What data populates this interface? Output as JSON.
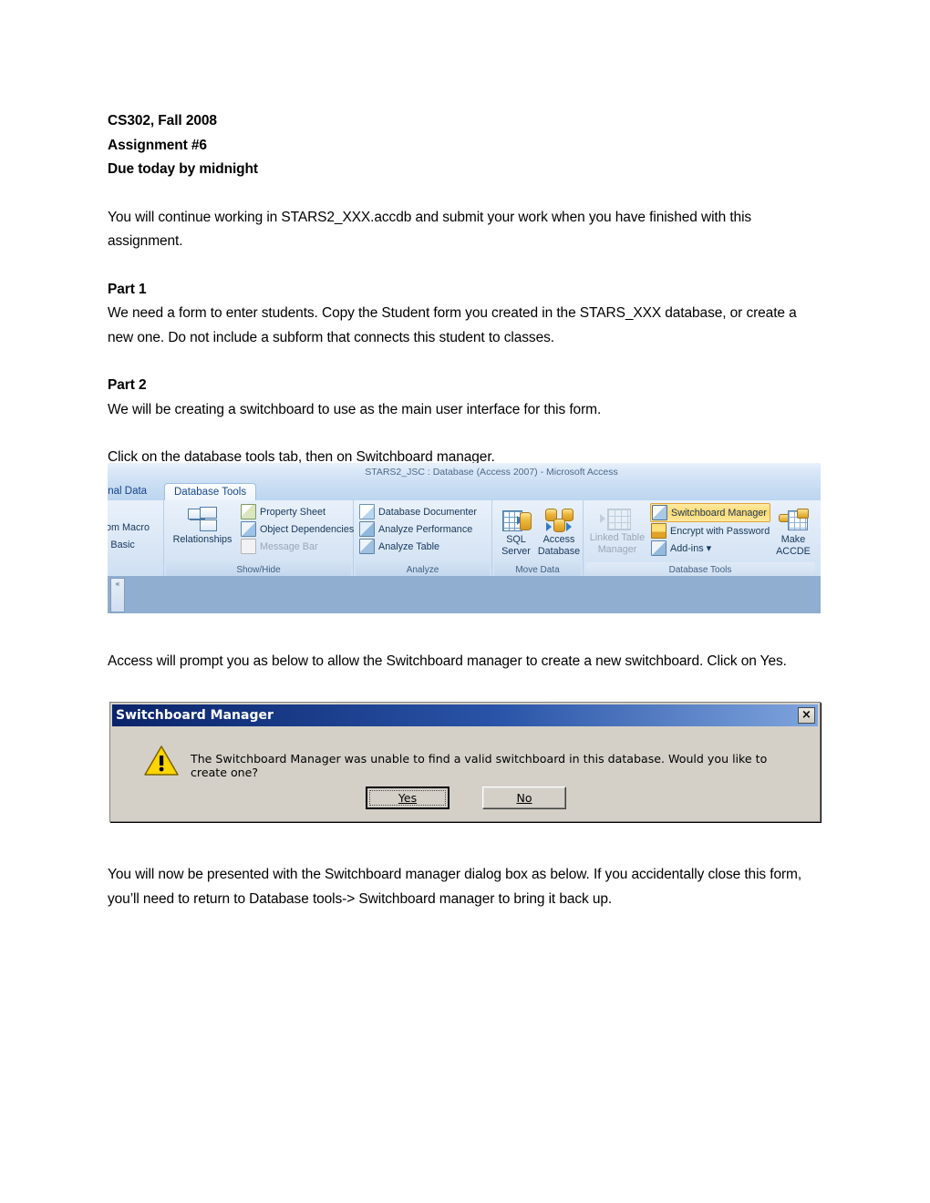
{
  "document": {
    "header_lines": [
      "CS302, Fall 2008",
      "Assignment #6",
      "Due today by midnight"
    ],
    "intro_paragraph": "You will continue working in STARS2_XXX.accdb and submit your work when you have finished with this assignment.",
    "part1_heading": "Part 1",
    "part1_paragraph": "We need a form to enter students. Copy the Student form you created in the STARS_XXX database, or create a new one. Do not include a subform that connects this student to classes.",
    "part2_heading": "Part 2",
    "part2_paragraph": "We will be creating a switchboard to use as the main user interface for this form.",
    "instruction_click_tab": "Click on the database tools tab, then on Switchboard manager.",
    "instruction_prompt": "Access will prompt you as below to allow the Switchboard manager to create a new switchboard. Click on Yes.",
    "instruction_dialog": "You will now be presented with the Switchboard manager dialog box as below. If you accidentally close this form, you’ll need to return to Database tools-> Switchboard manager to bring it back up."
  },
  "ribbon_screenshot": {
    "window_title": "STARS2_JSC : Database (Access 2007) - Microsoft Access",
    "tabs": [
      {
        "label": "ernal Data",
        "active": false
      },
      {
        "label": "Database Tools",
        "active": true
      }
    ],
    "cut_group_items": [
      "om Macro",
      "l Basic"
    ],
    "groups": [
      {
        "name": "Show/Hide",
        "label": "Show/Hide",
        "big_button": {
          "label": "Relationships",
          "icon": "relationships-icon",
          "disabled": false
        },
        "items": [
          {
            "label": "Property Sheet",
            "icon": "property-sheet-icon",
            "disabled": false
          },
          {
            "label": "Object Dependencies",
            "icon": "object-dependencies-icon",
            "disabled": false
          },
          {
            "label": "Message Bar",
            "icon": "message-bar-icon",
            "disabled": true
          }
        ]
      },
      {
        "name": "Analyze",
        "label": "Analyze",
        "items": [
          {
            "label": "Database Documenter",
            "icon": "database-documenter-icon",
            "disabled": false
          },
          {
            "label": "Analyze Performance",
            "icon": "analyze-performance-icon",
            "disabled": false
          },
          {
            "label": "Analyze Table",
            "icon": "analyze-table-icon",
            "disabled": false
          }
        ]
      },
      {
        "name": "Move Data",
        "label": "Move Data",
        "big_buttons": [
          {
            "label_line1": "SQL",
            "label_line2": "Server",
            "icon": "sql-server-icon",
            "disabled": false
          },
          {
            "label_line1": "Access",
            "label_line2": "Database",
            "icon": "access-database-icon",
            "disabled": false
          }
        ]
      },
      {
        "name": "Database Tools",
        "label": "Database Tools",
        "big_buttons": [
          {
            "label_line1": "Linked Table",
            "label_line2": "Manager",
            "icon": "linked-table-manager-icon",
            "disabled": true
          },
          {
            "label_line1": "Make",
            "label_line2": "ACCDE",
            "icon": "make-accde-icon",
            "disabled": false
          }
        ],
        "items": [
          {
            "label": "Switchboard Manager",
            "icon": "switchboard-manager-icon",
            "highlighted": true,
            "disabled": false
          },
          {
            "label": "Encrypt with Password",
            "icon": "encrypt-password-icon",
            "disabled": false
          },
          {
            "label": "Add-ins ▾",
            "icon": "add-ins-icon",
            "disabled": false
          }
        ]
      }
    ],
    "navpane_collapse_glyph": "«",
    "highlight_color": "#ffd970"
  },
  "dialog_screenshot": {
    "title": "Switchboard Manager",
    "close_glyph": "×",
    "message": "The Switchboard Manager was unable to find a valid switchboard in this database.  Would you like to create one?",
    "warning_icon": "warning-triangle-icon",
    "buttons": [
      {
        "label": "Yes",
        "accel": "Y",
        "default": true
      },
      {
        "label": "No",
        "accel": "N",
        "default": false
      }
    ],
    "titlebar_color": "#0a246a"
  }
}
